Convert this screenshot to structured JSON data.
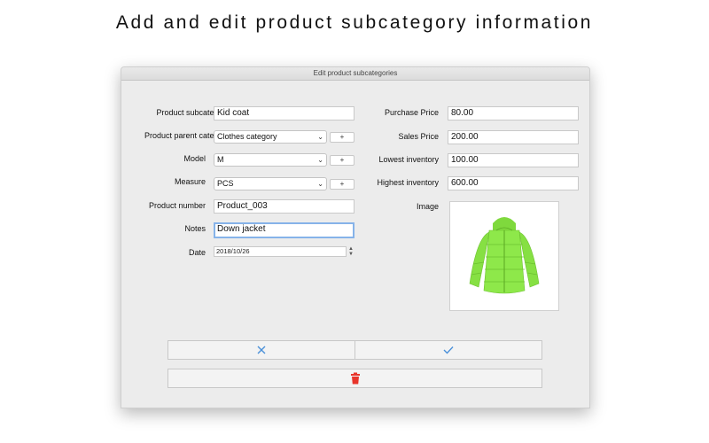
{
  "headline": "Add and edit product subcategory information",
  "window": {
    "title": "Edit product subcategories"
  },
  "form": {
    "left": {
      "subcategory_label": "Product subcategory",
      "subcategory_value": "Kid coat",
      "parent_label": "Product parent category",
      "parent_value": "Clothes category",
      "model_label": "Model",
      "model_value": "M",
      "measure_label": "Measure",
      "measure_value": "PCS",
      "number_label": "Product number",
      "number_value": "Product_003",
      "notes_label": "Notes",
      "notes_value": "Down jacket",
      "date_label": "Date",
      "date_value": "2018/10/26",
      "plus_label": "+"
    },
    "right": {
      "purchase_label": "Purchase Price",
      "purchase_value": "80.00",
      "sales_label": "Sales Price",
      "sales_value": "200.00",
      "lowest_label": "Lowest inventory",
      "lowest_value": "100.00",
      "highest_label": "Highest inventory",
      "highest_value": "600.00",
      "image_label": "Image"
    }
  },
  "buttons": {
    "cancel_icon": "close-icon",
    "confirm_icon": "checkmark-icon",
    "delete_icon": "trash-icon"
  },
  "colors": {
    "accent_blue": "#4a90d9",
    "delete_red": "#e8352b",
    "jacket_green": "#8ee84a",
    "focus_ring": "#86b3e9"
  }
}
